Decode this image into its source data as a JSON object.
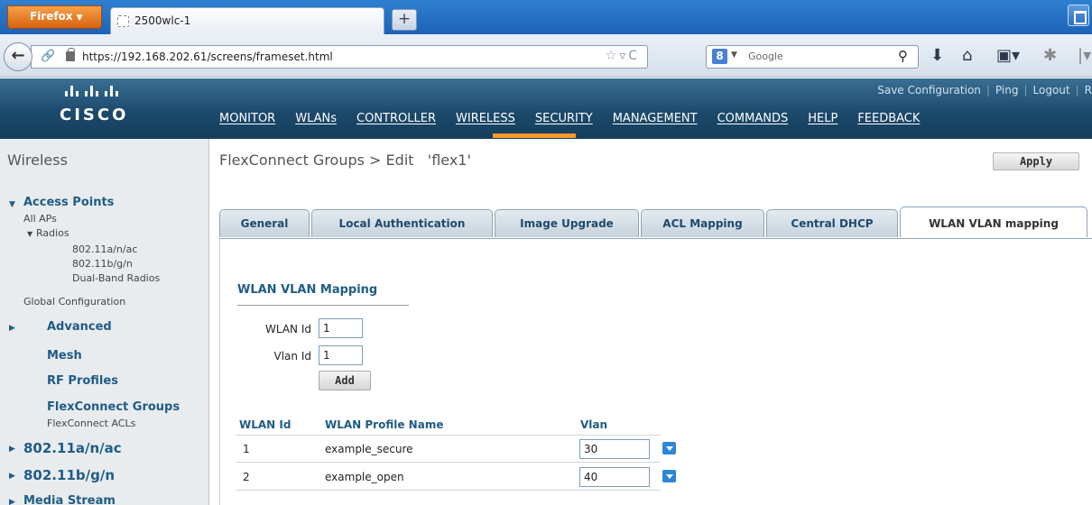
{
  "browser": {
    "menu_button_label": "Firefox",
    "tab_title": "2500wlc-1",
    "new_tab_label": "+",
    "url": "https://192.168.202.61/screens/frameset.html",
    "search_engine": "Google"
  },
  "header": {
    "brand": "CISCO",
    "links": [
      "Save Configuration",
      "Ping",
      "Logout",
      "R"
    ],
    "menu": [
      "MONITOR",
      "WLANs",
      "CONTROLLER",
      "WIRELESS",
      "SECURITY",
      "MANAGEMENT",
      "COMMANDS",
      "HELP",
      "FEEDBACK"
    ],
    "active_menu": "WIRELESS",
    "accent_color": "#f49a2c"
  },
  "sidebar": {
    "title": "Wireless",
    "access_points": "Access Points",
    "all_aps": "All APs",
    "radios": "Radios",
    "radio_items": [
      "802.11a/n/ac",
      "802.11b/g/n",
      "Dual-Band Radios"
    ],
    "global_configuration": "Global Configuration",
    "advanced": "Advanced",
    "mesh": "Mesh",
    "rf_profiles": "RF Profiles",
    "flexconnect_groups": "FlexConnect Groups",
    "flexconnect_acls": "FlexConnect ACLs",
    "band_a": "802.11a/n/ac",
    "band_b": "802.11b/g/n",
    "media_stream": "Media Stream"
  },
  "content": {
    "breadcrumb": "FlexConnect Groups > Edit   'flex1'",
    "apply_label": "Apply",
    "tabs": [
      "General",
      "Local Authentication",
      "Image Upgrade",
      "ACL Mapping",
      "Central DHCP",
      "WLAN VLAN mapping"
    ],
    "active_tab": "WLAN VLAN mapping",
    "section_title": "WLAN VLAN Mapping",
    "wlan_id_label": "WLAN Id",
    "wlan_id_value": "1",
    "vlan_id_label": "Vlan Id",
    "vlan_id_value": "1",
    "add_label": "Add",
    "table": {
      "columns": [
        "WLAN Id",
        "WLAN Profile Name",
        "Vlan"
      ],
      "rows": [
        {
          "wlan_id": "1",
          "profile": "example_secure",
          "vlan": "30"
        },
        {
          "wlan_id": "2",
          "profile": "example_open",
          "vlan": "40"
        }
      ]
    }
  }
}
